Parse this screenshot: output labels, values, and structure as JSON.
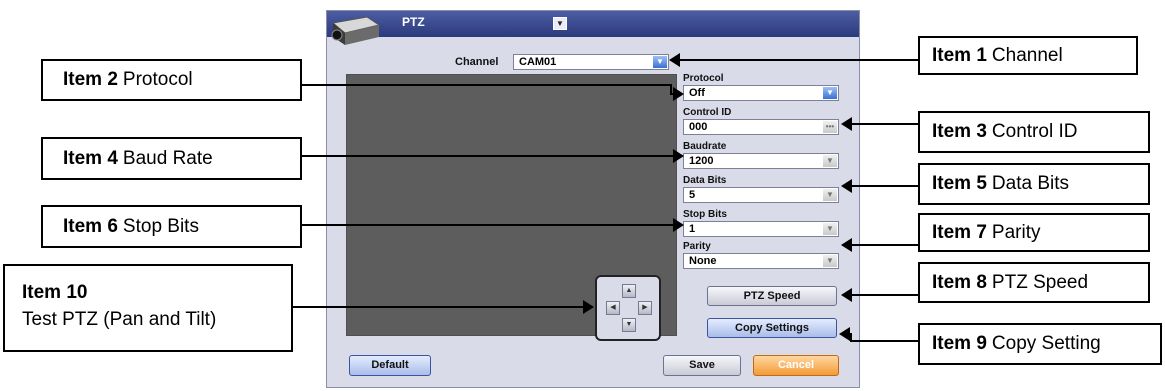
{
  "dialog": {
    "title": "PTZ",
    "channel": {
      "label": "Channel",
      "value": "CAM01"
    },
    "protocol": {
      "label": "Protocol",
      "value": "Off"
    },
    "control_id": {
      "label": "Control ID",
      "value": "000"
    },
    "baudrate": {
      "label": "Baudrate",
      "value": "1200"
    },
    "data_bits": {
      "label": "Data Bits",
      "value": "5"
    },
    "stop_bits": {
      "label": "Stop Bits",
      "value": "1"
    },
    "parity": {
      "label": "Parity",
      "value": "None"
    },
    "ptz_speed_label": "PTZ Speed",
    "copy_settings_label": "Copy Settings",
    "default_label": "Default",
    "save_label": "Save",
    "cancel_label": "Cancel",
    "ptz_pad": {
      "icons": [
        "arrow-up-icon",
        "arrow-left-icon",
        "arrow-right-icon",
        "arrow-down-icon"
      ]
    }
  },
  "callouts": {
    "item1": {
      "num": "Item 1",
      "text": "Channel"
    },
    "item2": {
      "num": "Item 2",
      "text": "Protocol"
    },
    "item3": {
      "num": "Item 3",
      "text": "Control ID"
    },
    "item4": {
      "num": "Item 4",
      "text": "Baud Rate"
    },
    "item5": {
      "num": "Item 5",
      "text": "Data Bits"
    },
    "item6": {
      "num": "Item 6",
      "text": "Stop Bits"
    },
    "item7": {
      "num": "Item 7",
      "text": "Parity"
    },
    "item8": {
      "num": "Item 8",
      "text": "PTZ Speed"
    },
    "item9": {
      "num": "Item 9",
      "text": "Copy Setting"
    },
    "item10": {
      "num": "Item 10",
      "text": "Test PTZ (Pan and Tilt)"
    }
  },
  "colors": {
    "title_bar": "#2b3a7c",
    "accent_blue": "#3a6fd4",
    "cancel_orange": "#f39b37",
    "preview": "#5d5d5d"
  }
}
